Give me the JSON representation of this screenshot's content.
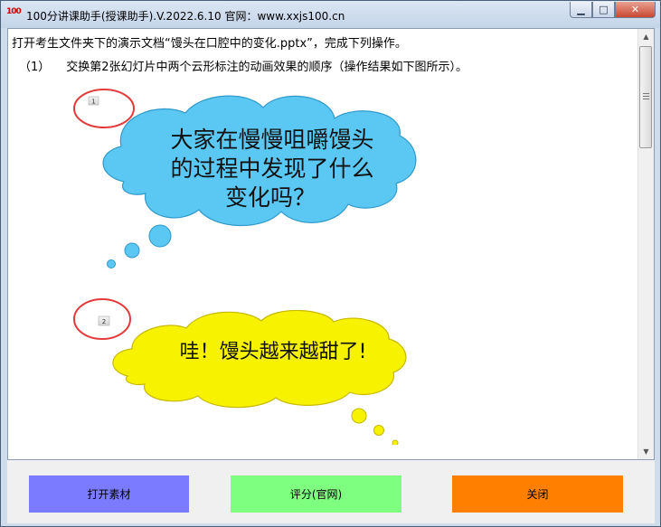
{
  "window": {
    "title": "100分讲课助手(授课助手).V.2022.6.10  官网：www.xxjs100.cn",
    "icon_label": "100"
  },
  "instructions": {
    "line1": "打开考生文件夹下的演示文档“馒头在口腔中的变化.pptx”，完成下列操作。",
    "line2_num": "（1）",
    "line2": "交换第2张幻灯片中两个云形标注的动画效果的顺序（操作结果如下图所示）。"
  },
  "slide": {
    "tag1": "1",
    "tag2": "2",
    "cloud1_lines": [
      "大家在慢慢咀嚼馒头",
      "的过程中发现了什么",
      "变化吗？"
    ],
    "cloud2_text": "哇！馒头越来越甜了!",
    "colors": {
      "cloud1": "#5bc8f4",
      "cloud2": "#f7f200",
      "ring": "#e43a3a"
    }
  },
  "buttons": {
    "open": "打开素材",
    "score": "评分(官网)",
    "close": "关闭",
    "colors": {
      "open": "#7b7bff",
      "score": "#7fff7f",
      "close": "#ff8000"
    }
  }
}
